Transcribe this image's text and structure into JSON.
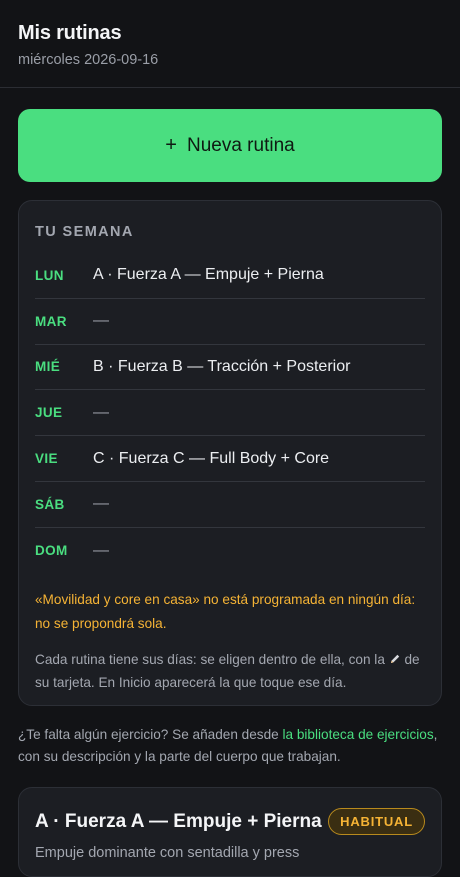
{
  "header": {
    "title": "Mis rutinas",
    "date": "miércoles 2026-09-16"
  },
  "new_routine_button": {
    "icon": "+",
    "label": "Nueva rutina"
  },
  "week": {
    "title": "TU SEMANA",
    "days": [
      {
        "abbr": "LUN",
        "routine": "A · Fuerza A — Empuje + Pierna"
      },
      {
        "abbr": "MAR",
        "routine": "—"
      },
      {
        "abbr": "MIÉ",
        "routine": "B · Fuerza B — Tracción + Posterior"
      },
      {
        "abbr": "JUE",
        "routine": "—"
      },
      {
        "abbr": "VIE",
        "routine": "C · Fuerza C — Full Body + Core"
      },
      {
        "abbr": "SÁB",
        "routine": "—"
      },
      {
        "abbr": "DOM",
        "routine": "—"
      }
    ],
    "warning": "«Movilidad y core en casa» no está programada en ningún día: no se propondrá sola.",
    "info_part1": "Cada rutina tiene sus días: se eligen dentro de ella, con la",
    "info_part2": "de su tarjeta. En Inicio aparecerá la que toque ese día."
  },
  "help": {
    "prefix": "¿Te falta algún ejercicio? Se añaden desde ",
    "link": "la biblioteca de ejercicios",
    "suffix": ", con su descripción y la parte del cuerpo que trabajan."
  },
  "routine_card": {
    "name": "A · Fuerza A — Empuje + Pierna",
    "badge": "HABITUAL",
    "description": "Empuje dominante con sentadilla y press"
  }
}
